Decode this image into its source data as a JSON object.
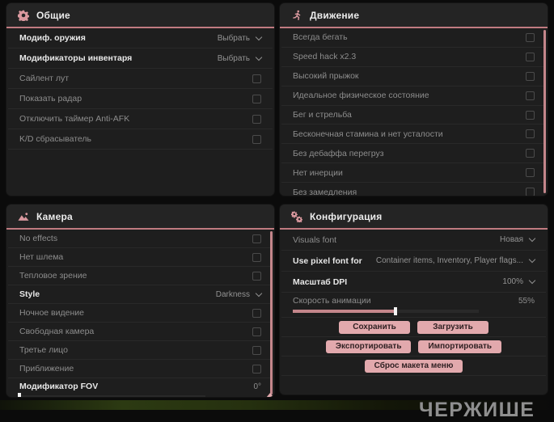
{
  "colors": {
    "accent_pink": "#d9989e",
    "header_underline": "#c07b81",
    "button_bg": "#e2a9ad",
    "button_text": "#2e1f21",
    "scrollbar": "#c4868b"
  },
  "watermark": "ЧЕРЖИШЕ",
  "panels": [
    {
      "title": "Общие",
      "icon": "gear-icon",
      "scrollbar": false,
      "rows": [
        {
          "type": "dropdown",
          "label": "Модиф. оружия",
          "value": "Выбрать",
          "bold": true
        },
        {
          "type": "dropdown",
          "label": "Модификаторы инвентаря",
          "value": "Выбрать",
          "bold": true
        },
        {
          "type": "checkbox",
          "label": "Сайлент лут",
          "checked": false
        },
        {
          "type": "checkbox",
          "label": "Показать радар",
          "checked": false
        },
        {
          "type": "checkbox",
          "label": "Отключить таймер Anti-AFK",
          "checked": false
        },
        {
          "type": "checkbox",
          "label": "K/D сбрасыватель",
          "checked": false
        }
      ]
    },
    {
      "title": "Движение",
      "icon": "runner-icon",
      "scrollbar": true,
      "rows": [
        {
          "type": "checkbox",
          "label": "Всегда бегать",
          "checked": false
        },
        {
          "type": "checkbox",
          "label": "Speed hack x2.3",
          "checked": false
        },
        {
          "type": "checkbox",
          "label": "Высокий прыжок",
          "checked": false
        },
        {
          "type": "checkbox",
          "label": "Идеальное физическое состояние",
          "checked": false
        },
        {
          "type": "checkbox",
          "label": "Бег и стрельба",
          "checked": false
        },
        {
          "type": "checkbox",
          "label": "Бесконечная стамина и нет усталости",
          "checked": false
        },
        {
          "type": "checkbox",
          "label": "Без дебаффа перегруз",
          "checked": false
        },
        {
          "type": "checkbox",
          "label": "Нет инерции",
          "checked": false
        },
        {
          "type": "checkbox",
          "label": "Без замедления",
          "checked": false
        }
      ]
    },
    {
      "title": "Камера",
      "icon": "image-icon",
      "scrollbar": true,
      "scroll_arrow": true,
      "rows": [
        {
          "type": "checkbox",
          "label": "No effects",
          "checked": false
        },
        {
          "type": "checkbox",
          "label": "Нет шлема",
          "checked": false
        },
        {
          "type": "checkbox",
          "label": "Тепловое зрение",
          "checked": false
        },
        {
          "type": "dropdown",
          "label": "Style",
          "value": "Darkness",
          "bold": true
        },
        {
          "type": "checkbox",
          "label": "Ночное видение",
          "checked": false
        },
        {
          "type": "checkbox",
          "label": "Свободная камера",
          "checked": false
        },
        {
          "type": "checkbox",
          "label": "Третье лицо",
          "checked": false
        },
        {
          "type": "checkbox",
          "label": "Приближение",
          "checked": false
        },
        {
          "type": "slider",
          "label": "Модификатор FOV",
          "value": "0°",
          "percent": 0,
          "bold": true
        }
      ]
    },
    {
      "title": "Конфигурация",
      "icon": "gears-icon",
      "scrollbar": false,
      "rows": [
        {
          "type": "dropdown",
          "label": "Visuals font",
          "value": "Новая",
          "bold": false
        },
        {
          "type": "dropdown",
          "label": "Use pixel font for",
          "value": "Container items, Inventory, Player flags...",
          "bold": true
        },
        {
          "type": "dropdown",
          "label": "Масштаб DPI",
          "value": "100%",
          "bold": true
        },
        {
          "type": "slider",
          "label": "Скорость анимации",
          "value": "55%",
          "percent": 55,
          "bold": false
        },
        {
          "type": "buttons",
          "buttons": [
            "Сохранить",
            "Загрузить"
          ]
        },
        {
          "type": "buttons",
          "buttons": [
            "Экспортировать",
            "Импортировать"
          ]
        },
        {
          "type": "buttons",
          "buttons": [
            "Сброс макета меню"
          ]
        }
      ]
    }
  ]
}
